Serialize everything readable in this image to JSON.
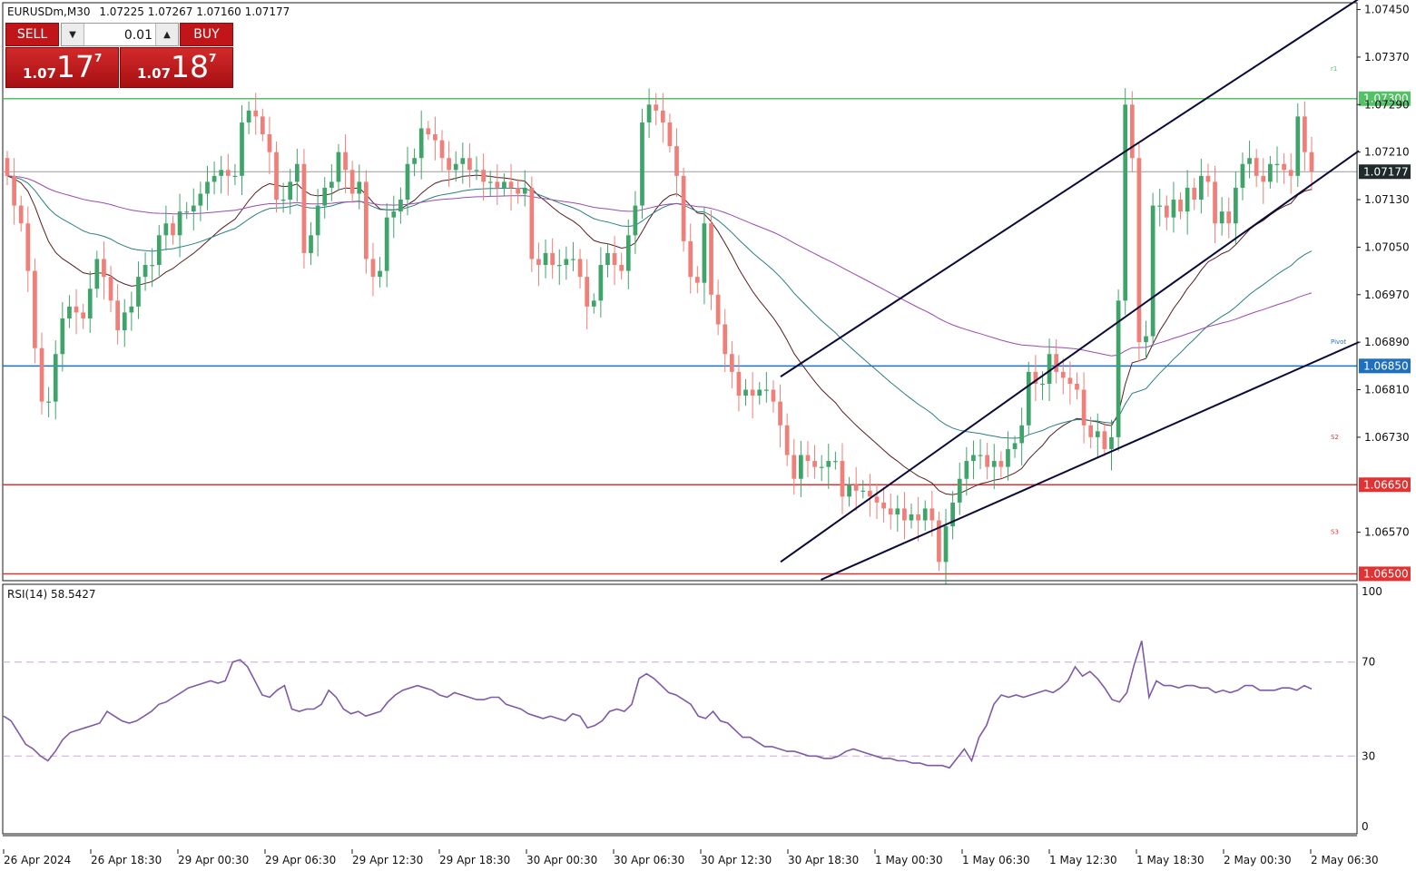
{
  "header": {
    "symbol": "EURUSDm,M30",
    "ohlc": "1.07225 1.07267 1.07160 1.07177"
  },
  "trade_panel": {
    "sell_label": "SELL",
    "buy_label": "BUY",
    "lot_value": "0.01",
    "bid_small": "1.07",
    "bid_big": "17",
    "bid_sup": "7",
    "ask_small": "1.07",
    "ask_big": "18",
    "ask_sup": "7"
  },
  "colors": {
    "bull": "#3fa46a",
    "bear": "#ef7f78",
    "ma_dark": "#5a1e1e",
    "ma_teal": "#2a7f80",
    "ma_purple": "#9b4ab0",
    "rsi": "#7e5aa8",
    "green_level": "#52c266",
    "blue_level": "#1f6fbf",
    "red_level": "#e03434",
    "channel": "#0b0b3a"
  },
  "chart_data": {
    "type": "candlestick",
    "title": "EURUSDm,M30",
    "timeframe": "M30",
    "ylim": [
      1.0649,
      1.0746
    ],
    "y_ticks": [
      "1.07450",
      "1.07370",
      "1.07290",
      "1.07210",
      "1.07130",
      "1.07050",
      "1.06970",
      "1.06890",
      "1.06810",
      "1.06730",
      "1.06570"
    ],
    "x_ticks": [
      "26 Apr 2024",
      "26 Apr 18:30",
      "29 Apr 00:30",
      "29 Apr 06:30",
      "29 Apr 12:30",
      "29 Apr 18:30",
      "30 Apr 00:30",
      "30 Apr 06:30",
      "30 Apr 12:30",
      "30 Apr 18:30",
      "1 May 00:30",
      "1 May 06:30",
      "1 May 12:30",
      "1 May 18:30",
      "2 May 00:30",
      "2 May 06:30"
    ],
    "current_price": "1.07177",
    "levels": [
      {
        "price": "1.07300",
        "color": "#52c266"
      },
      {
        "price": "1.06850",
        "color": "#1f6fbf"
      },
      {
        "price": "1.06650",
        "color": "#e03434"
      },
      {
        "price": "1.06500",
        "color": "#e03434"
      }
    ],
    "level_tags": [
      "Pivot",
      "S2",
      "S3",
      "r1"
    ],
    "channel": {
      "upper": [
        [
          1.06832,
          1.07468
        ]
      ],
      "middle": [
        [
          1.0652,
          1.07212
        ]
      ],
      "lower": [
        [
          1.0646,
          1.0689
        ]
      ]
    },
    "closes": [
      1.0717,
      1.0712,
      1.0709,
      1.0701,
      1.0688,
      1.0679,
      1.0679,
      1.0687,
      1.0693,
      1.0695,
      1.0694,
      1.0693,
      1.0698,
      1.0703,
      1.07,
      1.0696,
      1.0691,
      1.0694,
      1.0695,
      1.07,
      1.0702,
      1.0702,
      1.0707,
      1.0709,
      1.0707,
      1.0711,
      1.0711,
      1.0712,
      1.0714,
      1.0716,
      1.0717,
      1.0718,
      1.0717,
      1.0717,
      1.0726,
      1.0728,
      1.0727,
      1.0724,
      1.0721,
      1.0713,
      1.0713,
      1.0716,
      1.0719,
      1.0704,
      1.0707,
      1.0712,
      1.0715,
      1.0716,
      1.0721,
      1.0718,
      1.0714,
      1.0716,
      1.0703,
      1.07,
      1.0701,
      1.071,
      1.0711,
      1.0713,
      1.0719,
      1.072,
      1.0725,
      1.0724,
      1.0723,
      1.072,
      1.0718,
      1.0719,
      1.072,
      1.0718,
      1.0718,
      1.0716,
      1.0716,
      1.0715,
      1.0716,
      1.0715,
      1.0714,
      1.0715,
      1.0703,
      1.0702,
      1.0704,
      1.0702,
      1.0702,
      1.0703,
      1.0703,
      1.07,
      1.0695,
      1.0696,
      1.0702,
      1.0704,
      1.0702,
      1.0701,
      1.0707,
      1.0712,
      1.0726,
      1.0729,
      1.0728,
      1.0726,
      1.0722,
      1.0717,
      1.0706,
      1.07,
      1.0699,
      1.0709,
      1.0697,
      1.0692,
      1.0687,
      1.0684,
      1.068,
      1.0681,
      1.068,
      1.0681,
      1.0681,
      1.0679,
      1.0675,
      1.067,
      1.0666,
      1.067,
      1.0669,
      1.0668,
      1.0668,
      1.0669,
      1.0669,
      1.0663,
      1.0665,
      1.0664,
      1.0664,
      1.0663,
      1.0662,
      1.0661,
      1.066,
      1.0661,
      1.0659,
      1.066,
      1.0659,
      1.0661,
      1.0659,
      1.0652,
      1.0658,
      1.0662,
      1.0666,
      1.0669,
      1.067,
      1.067,
      1.0668,
      1.0669,
      1.0668,
      1.0671,
      1.0672,
      1.0675,
      1.0684,
      1.0682,
      1.0682,
      1.0687,
      1.0684,
      1.0683,
      1.0682,
      1.0681,
      1.0675,
      1.0673,
      1.0674,
      1.0671,
      1.0673,
      1.0696,
      1.0729,
      1.072,
      1.0689,
      1.069,
      1.0712,
      1.0712,
      1.071,
      1.0713,
      1.0711,
      1.0715,
      1.0713,
      1.0717,
      1.0716,
      1.0709,
      1.0711,
      1.0709,
      1.0715,
      1.0719,
      1.072,
      1.0717,
      1.0716,
      1.0719,
      1.0719,
      1.0718,
      1.0717,
      1.0727,
      1.0721,
      1.07177
    ],
    "ma_series": [
      "dark red",
      "teal",
      "purple"
    ],
    "rsi": {
      "label": "RSI(14) 58.5427",
      "period": 14,
      "current": 58.5427,
      "ylim": [
        0,
        100
      ],
      "levels": [
        30,
        70
      ],
      "y_ticks": [
        "100",
        "70",
        "30",
        "0"
      ],
      "values": [
        47,
        45,
        40,
        35,
        33,
        30,
        28,
        32,
        37,
        40,
        41,
        42,
        43,
        44,
        49,
        47,
        45,
        44,
        45,
        47,
        49,
        52,
        53,
        55,
        57,
        59,
        60,
        61,
        62,
        61,
        62,
        70,
        71,
        68,
        62,
        56,
        55,
        58,
        60,
        50,
        49,
        50,
        50,
        52,
        58,
        55,
        50,
        48,
        49,
        47,
        48,
        49,
        53,
        56,
        58,
        59,
        60,
        59,
        58,
        56,
        55,
        57,
        56,
        55,
        54,
        54,
        55,
        55,
        52,
        51,
        50,
        48,
        47,
        46,
        47,
        46,
        45,
        48,
        47,
        42,
        43,
        45,
        49,
        50,
        49,
        52,
        63,
        65,
        63,
        60,
        57,
        56,
        54,
        52,
        47,
        46,
        49,
        45,
        44,
        41,
        38,
        38,
        36,
        34,
        34,
        33,
        32,
        32,
        31,
        30,
        30,
        29,
        29,
        30,
        32,
        33,
        32,
        31,
        30,
        29,
        29,
        28,
        28,
        27,
        27,
        26,
        26,
        26,
        25,
        29,
        33,
        28,
        38,
        43,
        52,
        56,
        55,
        56,
        55,
        56,
        57,
        58,
        57,
        59,
        62,
        68,
        64,
        66,
        63,
        59,
        54,
        53,
        57,
        69,
        79,
        55,
        62,
        60,
        60,
        59,
        60,
        60,
        59,
        59,
        57,
        58,
        57,
        58,
        60,
        60,
        58,
        58,
        58,
        59,
        59,
        58,
        60,
        58.5427
      ]
    }
  }
}
